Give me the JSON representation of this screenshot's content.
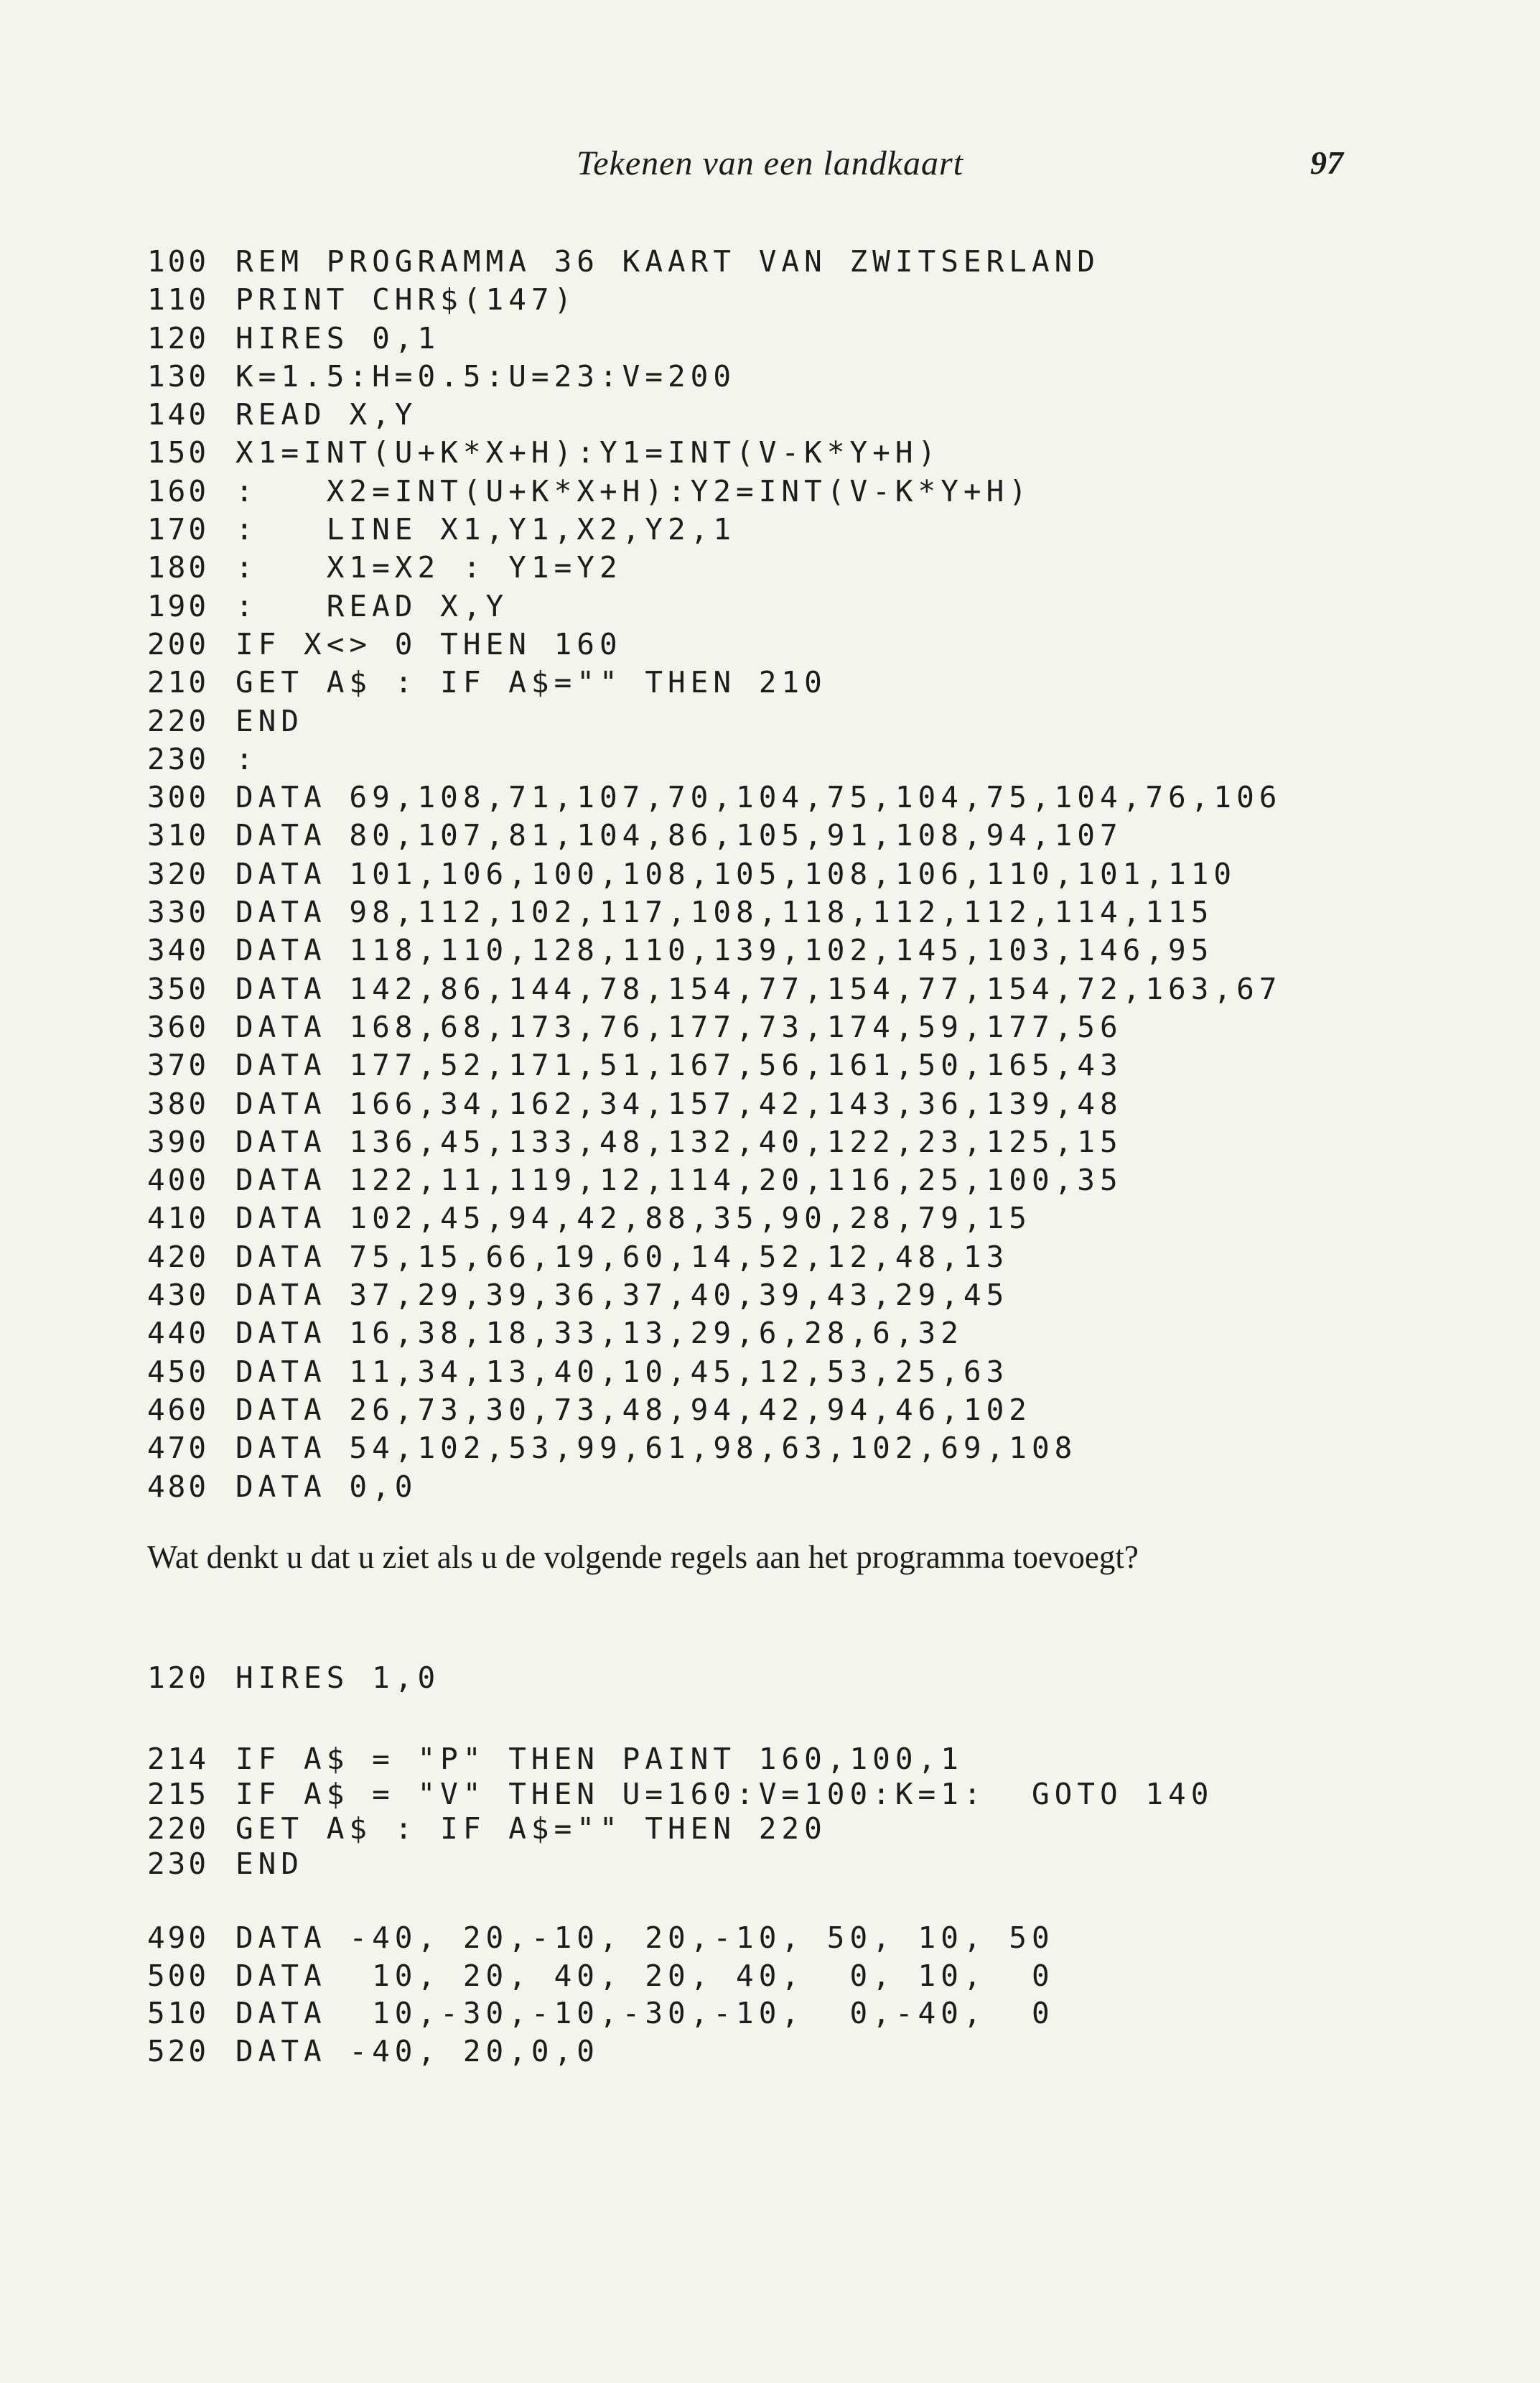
{
  "header": {
    "title": "Tekenen van een landkaart",
    "page_number": "97"
  },
  "listing": [
    {
      "num": "100",
      "code": "REM PROGRAMMA 36 KAART VAN ZWITSERLAND"
    },
    {
      "num": "110",
      "code": "PRINT CHR$(147)"
    },
    {
      "num": "120",
      "code": "HIRES 0,1"
    },
    {
      "num": "130",
      "code": "K=1.5:H=0.5:U=23:V=200"
    },
    {
      "num": "140",
      "code": "READ X,Y"
    },
    {
      "num": "150",
      "code": "X1=INT(U+K*X+H):Y1=INT(V-K*Y+H)"
    },
    {
      "num": "160",
      "code": ":   X2=INT(U+K*X+H):Y2=INT(V-K*Y+H)"
    },
    {
      "num": "170",
      "code": ":   LINE X1,Y1,X2,Y2,1"
    },
    {
      "num": "180",
      "code": ":   X1=X2 : Y1=Y2"
    },
    {
      "num": "190",
      "code": ":   READ X,Y"
    },
    {
      "num": "200",
      "code": "IF X<> 0 THEN 160"
    },
    {
      "num": "210",
      "code": "GET A$ : IF A$=\"\" THEN 210"
    },
    {
      "num": "220",
      "code": "END"
    },
    {
      "num": "230",
      "code": ":"
    },
    {
      "num": "300",
      "code": "DATA 69,108,71,107,70,104,75,104,75,104,76,106"
    },
    {
      "num": "310",
      "code": "DATA 80,107,81,104,86,105,91,108,94,107"
    },
    {
      "num": "320",
      "code": "DATA 101,106,100,108,105,108,106,110,101,110"
    },
    {
      "num": "330",
      "code": "DATA 98,112,102,117,108,118,112,112,114,115"
    },
    {
      "num": "340",
      "code": "DATA 118,110,128,110,139,102,145,103,146,95"
    },
    {
      "num": "350",
      "code": "DATA 142,86,144,78,154,77,154,77,154,72,163,67"
    },
    {
      "num": "360",
      "code": "DATA 168,68,173,76,177,73,174,59,177,56"
    },
    {
      "num": "370",
      "code": "DATA 177,52,171,51,167,56,161,50,165,43"
    },
    {
      "num": "380",
      "code": "DATA 166,34,162,34,157,42,143,36,139,48"
    },
    {
      "num": "390",
      "code": "DATA 136,45,133,48,132,40,122,23,125,15"
    },
    {
      "num": "400",
      "code": "DATA 122,11,119,12,114,20,116,25,100,35"
    },
    {
      "num": "410",
      "code": "DATA 102,45,94,42,88,35,90,28,79,15"
    },
    {
      "num": "420",
      "code": "DATA 75,15,66,19,60,14,52,12,48,13"
    },
    {
      "num": "430",
      "code": "DATA 37,29,39,36,37,40,39,43,29,45"
    },
    {
      "num": "440",
      "code": "DATA 16,38,18,33,13,29,6,28,6,32"
    },
    {
      "num": "450",
      "code": "DATA 11,34,13,40,10,45,12,53,25,63"
    },
    {
      "num": "460",
      "code": "DATA 26,73,30,73,48,94,42,94,46,102"
    },
    {
      "num": "470",
      "code": "DATA 54,102,53,99,61,98,63,102,69,108"
    },
    {
      "num": "480",
      "code": "DATA 0,0"
    }
  ],
  "question": "Wat denkt u dat u ziet als u de volgende regels aan het programma toevoegt?",
  "additions": [
    [
      {
        "num": "120",
        "code": "HIRES 1,0"
      }
    ],
    [
      {
        "num": "214",
        "code": "IF A$ = \"P\" THEN PAINT 160,100,1"
      },
      {
        "num": "215",
        "code": "IF A$ = \"V\" THEN U=160:V=100:K=1:  GOTO 140"
      },
      {
        "num": "220",
        "code": "GET A$ : IF A$=\"\" THEN 220"
      },
      {
        "num": "230",
        "code": "END"
      }
    ],
    [
      {
        "num": "490",
        "code": "DATA -40, 20,-10, 20,-10, 50, 10, 50"
      },
      {
        "num": "500",
        "code": "DATA  10, 20, 40, 20, 40,  0, 10,  0"
      },
      {
        "num": "510",
        "code": "DATA  10,-30,-10,-30,-10,  0,-40,  0"
      },
      {
        "num": "520",
        "code": "DATA -40, 20,0,0"
      }
    ]
  ]
}
